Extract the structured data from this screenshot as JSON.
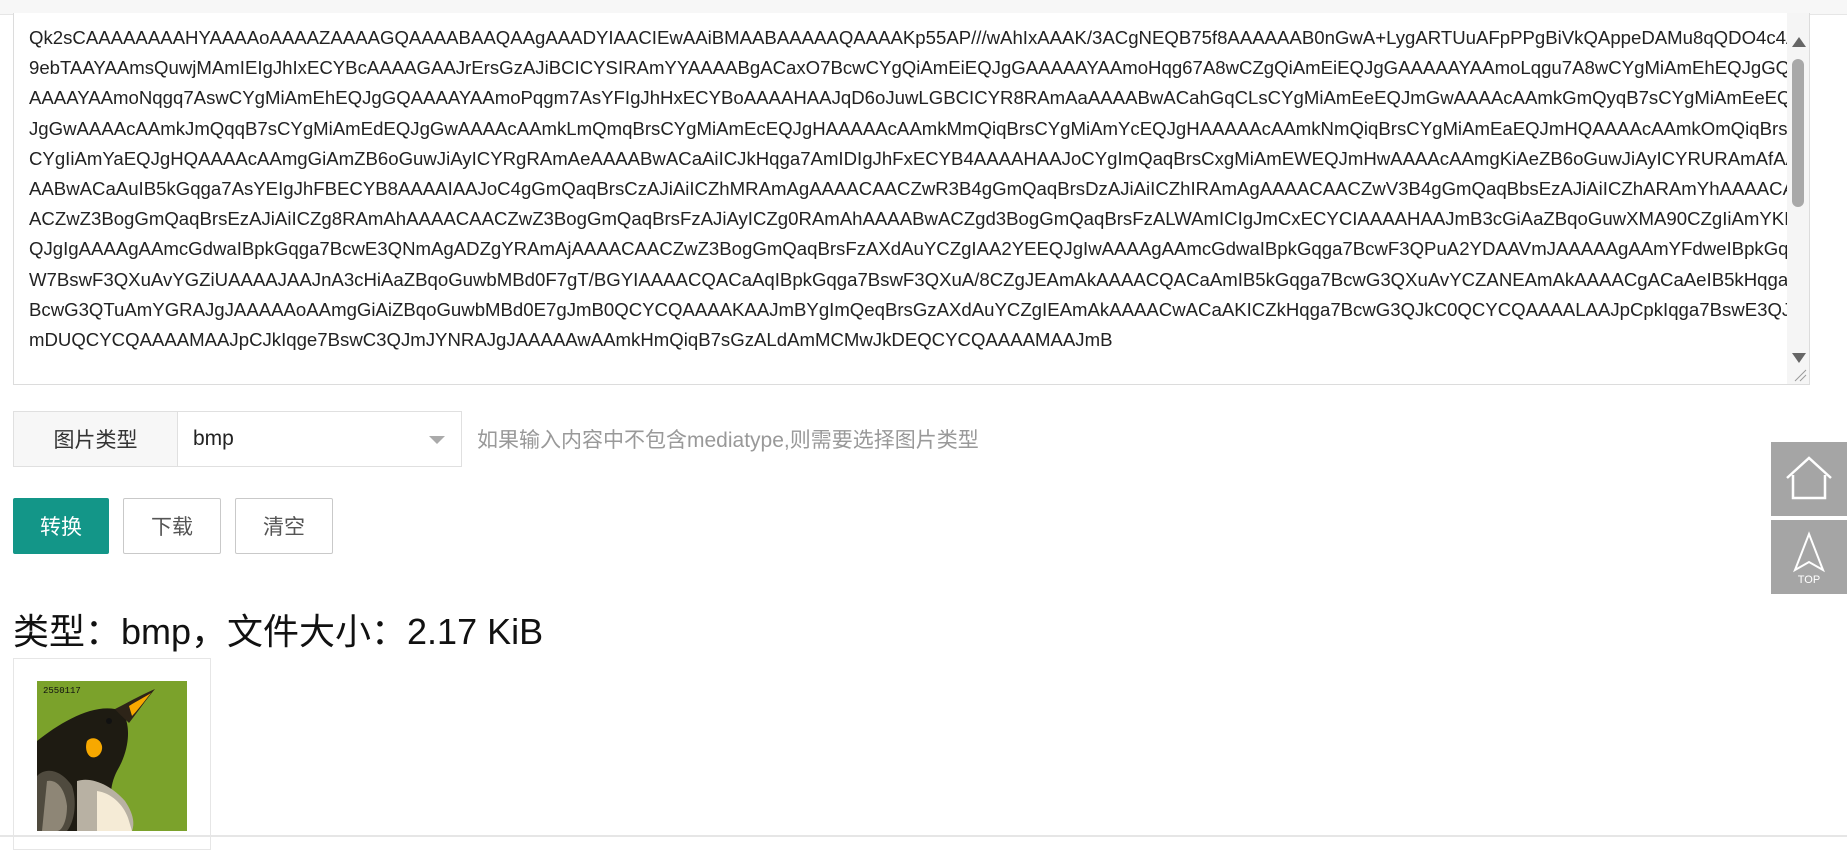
{
  "textarea": {
    "content": "Qk2sCAAAAAAAAHYAAAAoAAAAZAAAAGQAAAABAAQAAgAAADYIAACIEwAAiBMAABAAAAAQAAAAKp55AP///wAhIxAAAK/3ACgNEQB75f8AAAAAAB0nGwA+LygARTUuAFpPPgBiVkQAppeDAMu8qQDO4c4A9ebTAAYAAmsQuwjMAmIEIgJhIxECYBcAAAAGAAJrErsGzAJiBCICYSIRAmYYAAAABgACaxO7BcwCYgQiAmEiEQJgGAAAAAYAAmoHqg67A8wCZgQiAmEiEQJgGAAAAAYAAmoLqgu7A8wCYgMiAmEhEQJgGQAAAAYAAmoNqgq7AswCYgMiAmEhEQJgGQAAAAYAAmoPqgm7AsYFIgJhHxECYBoAAAAHAAJqD6oJuwLGBCICYR8RAmAaAAAABwACahGqCLsCYgMiAmEeEQJmGwAAAAcAAmkGmQyqB7sCYgMiAmEeEQJgGwAAAAcAAmkJmQqqB7sCYgMiAmEdEQJgGwAAAAcAAmkLmQmqBrsCYgMiAmEcEQJgHAAAAAcAAmkMmQiqBrsCYgMiAmYcEQJgHAAAAAcAAmkNmQiqBrsCYgMiAmEaEQJmHQAAAAcAAmkOmQiqBrsCYgIiAmYaEQJgHQAAAAcAAmgGiAmZB6oGuwJiAyICYRgRAmAeAAAABwACaAiICJkHqga7AmIDIgJhFxECYB4AAAAHAAJoCYgImQaqBrsCxgMiAmEWEQJmHwAAAAcAAmgKiAeZB6oGuwJiAyICYRURAmAfAAAABwACaAuIB5kGqga7AsYEIgJhFBECYB8AAAAIAAJoC4gGmQaqBrsCzAJiAiICZhMRAmAgAAAACAACZwR3B4gGmQaqBrsDzAJiAiICZhIRAmAgAAAACAACZwV3B4gGmQaqBbsEzAJiAiICZhARAmYhAAAACAACZwZ3BogGmQaqBrsEzAJiAiICZg8RAmAhAAAACAACZwZ3BogGmQaqBrsFzAJiAyICZg0RAmAhAAAABwACZgd3BogGmQaqBrsFzALWAmICIgJmCxECYCIAAAAHAAJmB3cGiAaZBqoGuwXMA90CZgIiAmYKEQJgIgAAAAgAAmcGdwaIBpkGqga7BcwE3QNmAgADZgYRAmAjAAAACAACZwZ3BogGmQaqBrsFzAXdAuYCZgIAA2YEEQJgIwAAAAgAAmcGdwaIBpkGqga7BcwF3QPuA2YDAAVmJAAAAAgAAmYFdweIBpkGqgW7BswF3QXuAvYGZiUAAAAJAAJnA3cHiAaZBqoGuwbMBd0F7gT/BGYIAAAACQACaAqIBpkGqga7BswF3QXuA/8CZgJEAmAkAAAACQACaAmIB5kGqga7BcwG3QXuAvYCZANEAmAkAAAACgACaAeIB5kHqga7BcwG3QTuAmYGRAJgJAAAAAoAAmgGiAiZBqoGuwbMBd0E7gJmB0QCYCQAAAAKAAJmBYgImQeqBrsGzAXdAuYCZgIEAmAkAAAACwACaAKICZkHqga7BcwG3QJkC0QCYCQAAAALAAJpCpkIqga7BswE3QJmDUQCYCQAAAAMAAJpCJkIqge7BswC3QJmJYNRAJgJAAAAAwAAmkHmQiqB7sGzALdAmMCMwJkDEQCYCQAAAAMAAJmB",
    "scrollbar_label": "vertical-scrollbar"
  },
  "image_type": {
    "label": "图片类型",
    "selected": "bmp",
    "hint": "如果输入内容中不包含mediatype,则需要选择图片类型"
  },
  "buttons": {
    "convert": "转换",
    "download": "下载",
    "clear": "清空"
  },
  "result": {
    "title": "类型：bmp，文件大小：2.17 KiB",
    "image_caption": "2550117"
  },
  "float": {
    "top_label": "TOP"
  },
  "colors": {
    "accent": "#139688",
    "float_bg": "#a5a5a5",
    "preview_green": "#7ba22b"
  }
}
